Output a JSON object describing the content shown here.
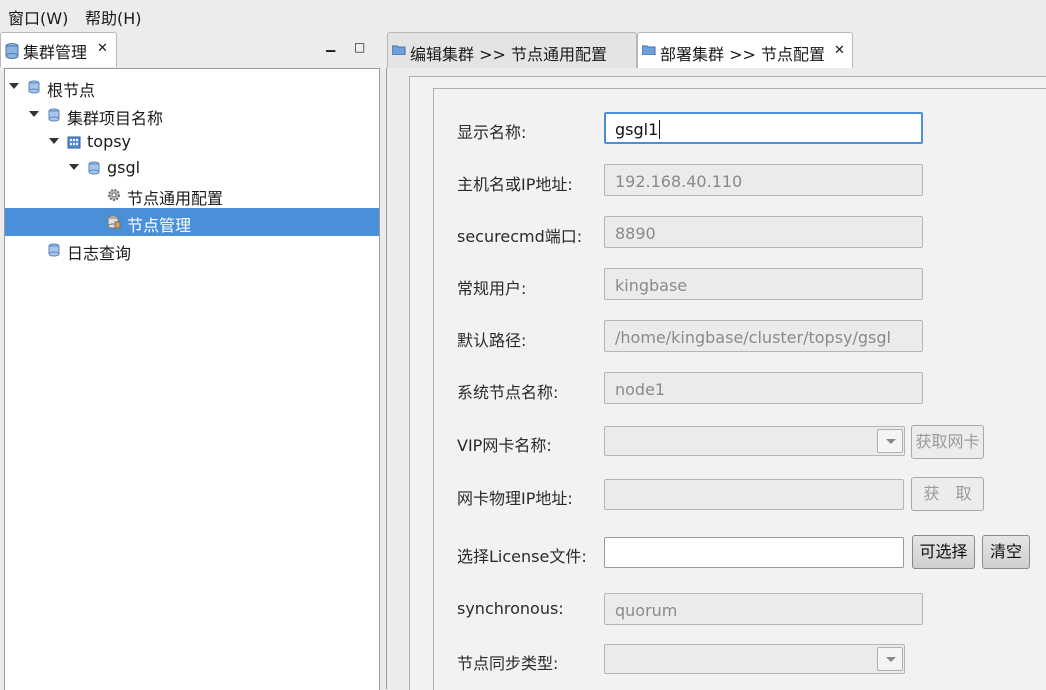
{
  "menu": {
    "window": "窗口(W)",
    "help": "帮助(H)"
  },
  "left_view": {
    "tab_label": "集群管理",
    "tree": [
      {
        "label": "根节点",
        "icon": "cluster-db-icon"
      },
      {
        "label": "集群项目名称",
        "icon": "cluster-db-icon"
      },
      {
        "label": "topsy",
        "icon": "building-icon"
      },
      {
        "label": "gsgl",
        "icon": "cluster-db-icon"
      },
      {
        "label": "节点通用配置",
        "icon": "gear-icon"
      },
      {
        "label": "节点管理",
        "icon": "node-db-icon",
        "selected": true
      },
      {
        "label": "日志查询",
        "icon": "cluster-db-icon"
      }
    ]
  },
  "editor_tabs": [
    {
      "label": "编辑集群 >> 节点通用配置",
      "active": false
    },
    {
      "label": "部署集群 >> 节点配置",
      "active": true
    }
  ],
  "form": {
    "display_name_label": "显示名称:",
    "display_name_value": "gsgl1",
    "host_label": "主机名或IP地址:",
    "host_value": "192.168.40.110",
    "port_label": "securecmd端口:",
    "port_value": "8890",
    "user_label": "常规用户:",
    "user_value": "kingbase",
    "path_label": "默认路径:",
    "path_value": "/home/kingbase/cluster/topsy/gsgl",
    "sysnode_label": "系统节点名称:",
    "sysnode_value": "node1",
    "vip_label": "VIP网卡名称:",
    "vip_value": "",
    "get_nic_button": "获取网卡",
    "phys_ip_label": "网卡物理IP地址:",
    "phys_ip_value": "",
    "get_button": "获　取",
    "license_label": "选择License文件:",
    "license_value": "",
    "choose_button": "可选择",
    "clear_button": "清空",
    "sync_label": "synchronous:",
    "sync_value": "quorum",
    "sync_type_label": "节点同步类型:",
    "sync_type_value": ""
  },
  "colors": {
    "selection": "#4a90d9",
    "focus_border": "#4a90d9",
    "panel_bg": "#ececec"
  }
}
